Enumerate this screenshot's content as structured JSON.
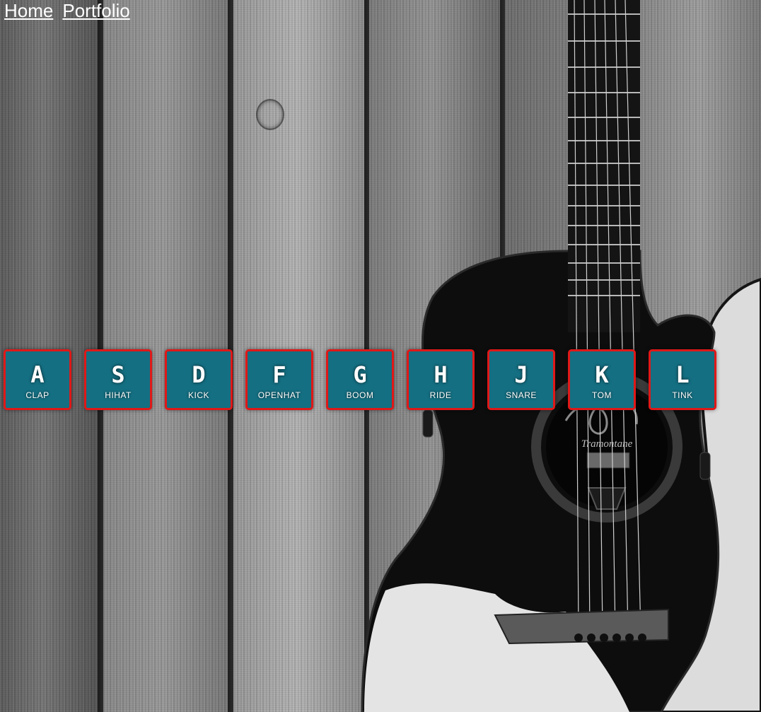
{
  "nav": {
    "links": [
      {
        "label": "Home"
      },
      {
        "label": "Portfolio"
      }
    ]
  },
  "drum_keys": [
    {
      "key": "A",
      "sound": "CLAP"
    },
    {
      "key": "S",
      "sound": "HIHAT"
    },
    {
      "key": "D",
      "sound": "KICK"
    },
    {
      "key": "F",
      "sound": "OPENHAT"
    },
    {
      "key": "G",
      "sound": "BOOM"
    },
    {
      "key": "H",
      "sound": "RIDE"
    },
    {
      "key": "J",
      "sound": "SNARE"
    },
    {
      "key": "K",
      "sound": "TOM"
    },
    {
      "key": "L",
      "sound": "TINK"
    }
  ],
  "guitar": {
    "brand": "Tramontane"
  },
  "colors": {
    "key_fill": "#146f82",
    "key_border": "#e01818",
    "text": "#ffffff"
  }
}
